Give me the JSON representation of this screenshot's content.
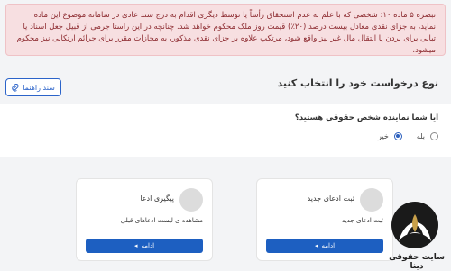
{
  "notice": {
    "text": "تبصره ۵ ماده ۱۰: شخصی که با علم به عدم استحقاق رأساً یا توسط دیگری اقدام به درج سند عادی در سامانه موضوع این ماده نماید، به جزای نقدی معادل بیست درصد (۲۰٪) قیمت روز ملک محکوم خواهد شد. چنانچه در این راستا جرمی از قبیل جعل اسناد یا تبانی برای بردن یا انتقال مال غیر نیز واقع شود، مرتکب علاوه بر جزای نقدی مذکور، به مجازات مقرر برای جرائم ارتکابی نیز محکوم میشود."
  },
  "header": {
    "title": "نوع درخواست خود را انتخاب کنید",
    "guide_label": "سند راهنما"
  },
  "question": {
    "text": "آیا شما نماینده شخص حقوقی هستید؟",
    "options": [
      {
        "label": "بله",
        "checked": false
      },
      {
        "label": "خیر",
        "checked": true
      }
    ]
  },
  "cards": [
    {
      "title": "ثبت ادعای جدید",
      "desc": "ثبت ادعای جدید",
      "button": "ادامه"
    },
    {
      "title": "پیگیری ادعا",
      "desc": "مشاهده ی لیست ادعاهای قبلی",
      "button": "ادامه"
    }
  ],
  "watermark": {
    "text": "سایت حقوقی دینا"
  },
  "colors": {
    "primary": "#1d5fc1",
    "alert_bg": "#f7dfe1",
    "alert_text": "#8c2a2f"
  }
}
